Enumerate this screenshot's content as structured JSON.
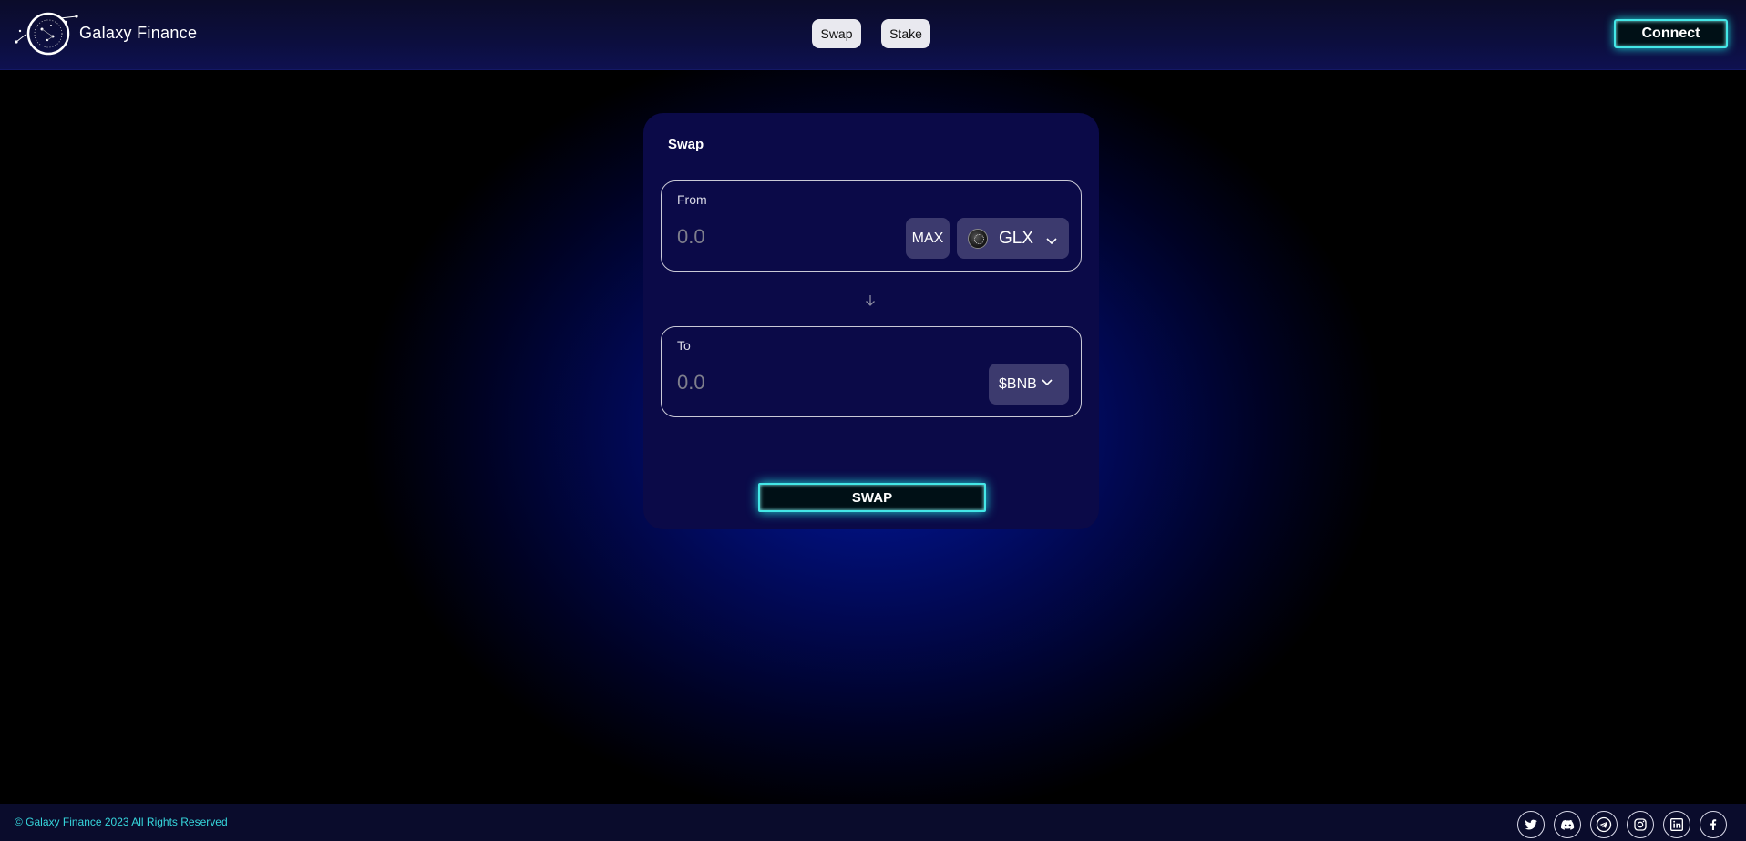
{
  "header": {
    "brand": "Galaxy Finance",
    "nav": [
      {
        "label": "Swap"
      },
      {
        "label": "Stake"
      }
    ],
    "connect_label": "Connect"
  },
  "swap": {
    "title": "Swap",
    "from": {
      "label": "From",
      "placeholder": "0.0",
      "max_label": "MAX",
      "token": "GLX"
    },
    "to": {
      "label": "To",
      "placeholder": "0.0",
      "token": "$BNB"
    },
    "submit_label": "SWAP"
  },
  "footer": {
    "copyright": "© Galaxy Finance 2023 All Rights Reserved",
    "socials": [
      "twitter-icon",
      "discord-icon",
      "telegram-icon",
      "instagram-icon",
      "linkedin-icon",
      "facebook-icon"
    ]
  },
  "colors": {
    "accent": "#44e7e7",
    "card_bg": "#0b0a48",
    "footer_text": "#36d6dc",
    "token_bg": "#3c3a6e"
  }
}
